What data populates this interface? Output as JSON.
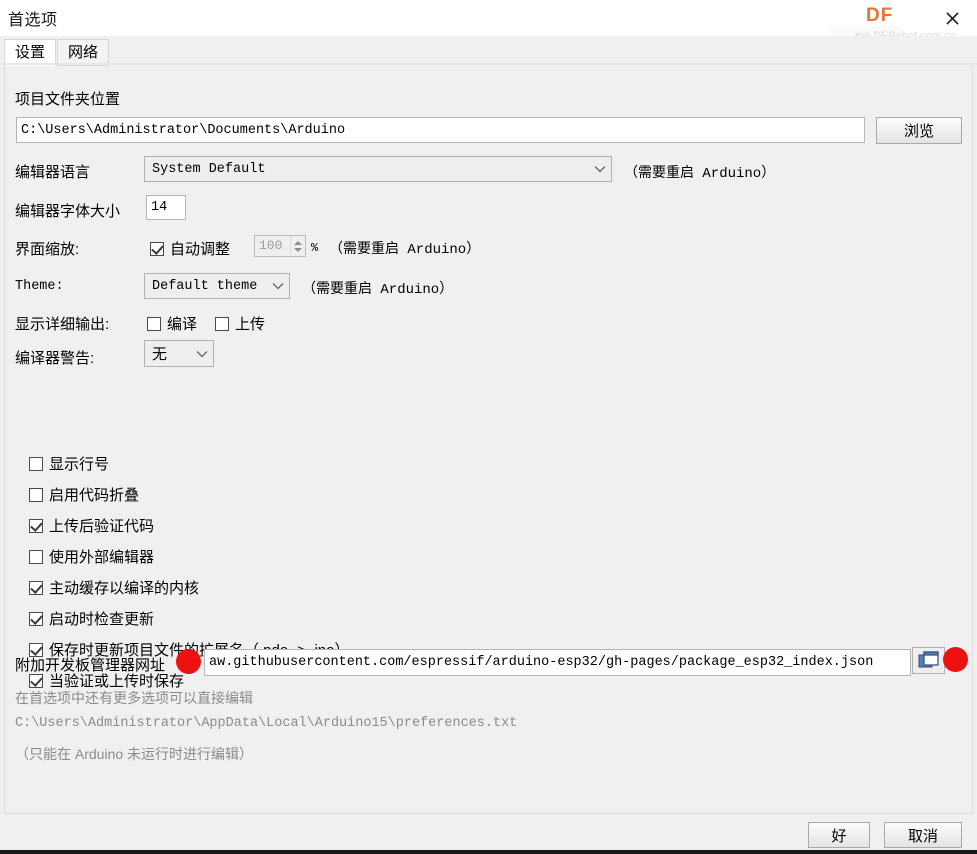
{
  "window": {
    "title": "首选项",
    "close_icon": "close-icon",
    "brand_logo": "DF",
    "brand_watermark": "me.DFRobot.com.cn"
  },
  "tabs": [
    {
      "label": "设置",
      "active": true
    },
    {
      "label": "网络",
      "active": false
    }
  ],
  "settings": {
    "sketchbook": {
      "label": "项目文件夹位置",
      "value": "C:\\Users\\Administrator\\Documents\\Arduino",
      "browse_label": "浏览"
    },
    "editor_language": {
      "label": "编辑器语言",
      "value": "System Default",
      "note": "（需要重启 Arduino）"
    },
    "editor_font_size": {
      "label": "编辑器字体大小",
      "value": "14"
    },
    "interface_scale": {
      "label": "界面缩放:",
      "auto_label": "自动调整",
      "auto_checked": true,
      "value": "100",
      "percent": "%",
      "note": "（需要重启 Arduino）"
    },
    "theme": {
      "label": "Theme:",
      "value": "Default theme",
      "note": "（需要重启 Arduino）"
    },
    "verbose_output": {
      "label": "显示详细输出:",
      "compile_label": "编译",
      "compile_checked": false,
      "upload_label": "上传",
      "upload_checked": false
    },
    "compiler_warnings": {
      "label": "编译器警告:",
      "value": "无"
    },
    "checkboxes": [
      {
        "label": "显示行号",
        "checked": false
      },
      {
        "label": "启用代码折叠",
        "checked": false
      },
      {
        "label": "上传后验证代码",
        "checked": true
      },
      {
        "label": "使用外部编辑器",
        "checked": false
      },
      {
        "label": "主动缓存以编译的内核",
        "checked": true
      },
      {
        "label": "启动时检查更新",
        "checked": true
      },
      {
        "label": "保存时更新项目文件的扩展名（.pde -> .ino）",
        "checked": true
      },
      {
        "label": "当验证或上传时保存",
        "checked": true
      }
    ],
    "board_manager_urls": {
      "label": "附加开发板管理器网址",
      "value": "aw.githubusercontent.com/espressif/arduino-esp32/gh-pages/package_esp32_index.json",
      "expand_icon": "window-popup-icon"
    },
    "footnotes": {
      "line1": "在首选项中还有更多选项可以直接编辑",
      "line2": "C:\\Users\\Administrator\\AppData\\Local\\Arduino15\\preferences.txt",
      "line3": "（只能在 Arduino 未运行时进行编辑）"
    }
  },
  "footer": {
    "ok_label": "好",
    "cancel_label": "取消"
  },
  "annotations": {
    "accent_color": "#ee1111"
  }
}
